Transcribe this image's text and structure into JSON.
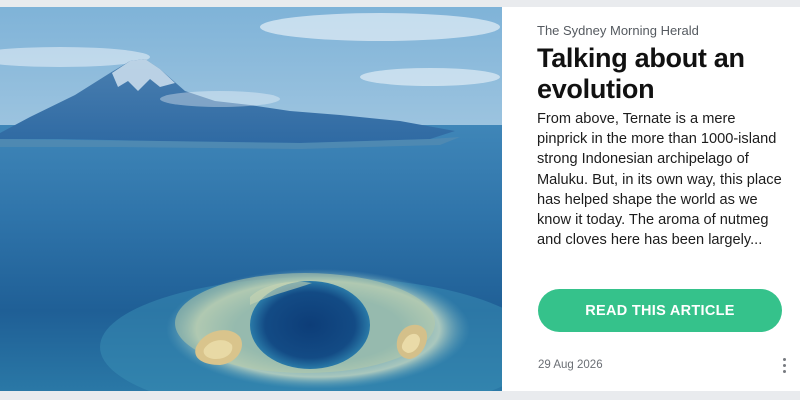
{
  "article": {
    "source": "The Sydney Morning Herald",
    "headline": "Talking about an evolution",
    "excerpt": "From above, Ternate is a mere pinprick in the more than 1000-island strong Indonesian archipelago of Maluku. But, in its own way, this place has helped shape the world as we know it today. The aroma of nutmeg and cloves here has been largely...",
    "cta_label": "READ THIS ARTICLE",
    "date": "29 Aug 2026",
    "more_icon": "more-vertical-icon"
  },
  "colors": {
    "cta": "#35c28b",
    "card": "#ffffff",
    "page": "#e9ebee"
  }
}
